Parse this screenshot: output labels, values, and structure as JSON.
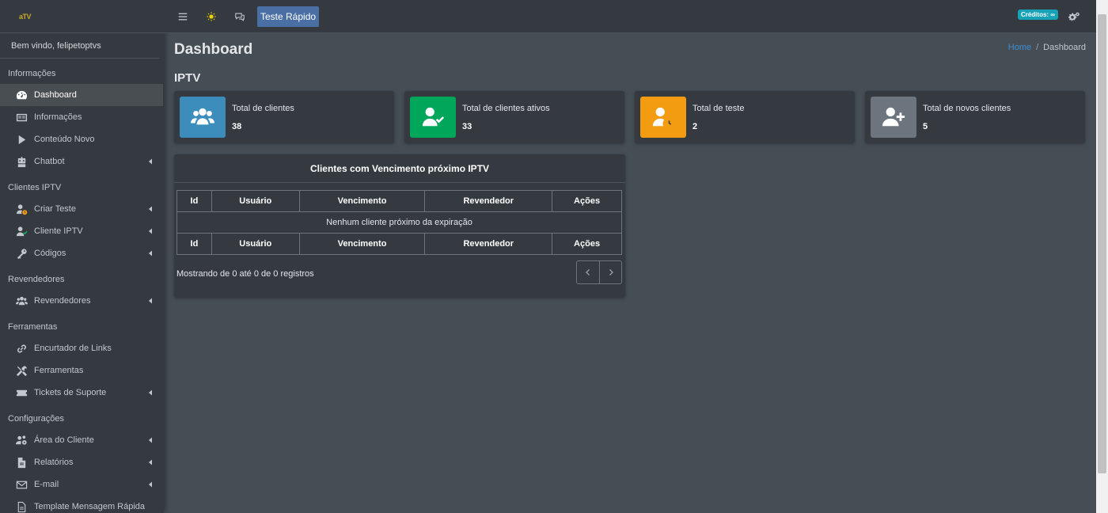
{
  "brand": {
    "logo_text": "aTV"
  },
  "sidebar": {
    "welcome": "Bem vindo, felipetoptvs",
    "sections": [
      {
        "header": "Informações",
        "items": [
          {
            "label": "Dashboard",
            "icon": "dashboard-icon",
            "active": true,
            "has_chevron": false
          },
          {
            "label": "Informações",
            "icon": "id-card-icon",
            "has_chevron": false
          },
          {
            "label": "Conteúdo Novo",
            "icon": "play-icon",
            "has_chevron": false
          },
          {
            "label": "Chatbot",
            "icon": "robot-icon",
            "has_chevron": true
          }
        ]
      },
      {
        "header": "Clientes IPTV",
        "items": [
          {
            "label": "Criar Teste",
            "icon": "user-clock-icon",
            "has_chevron": true
          },
          {
            "label": "Cliente IPTV",
            "icon": "user-check-icon",
            "has_chevron": true
          },
          {
            "label": "Códigos",
            "icon": "key-icon",
            "has_chevron": true
          }
        ]
      },
      {
        "header": "Revendedores",
        "items": [
          {
            "label": "Revendedores",
            "icon": "users-icon",
            "has_chevron": true
          }
        ]
      },
      {
        "header": "Ferramentas",
        "items": [
          {
            "label": "Encurtador de Links",
            "icon": "link-icon",
            "has_chevron": false
          },
          {
            "label": "Ferramentas",
            "icon": "tools-icon",
            "has_chevron": false
          },
          {
            "label": "Tickets de Suporte",
            "icon": "ticket-icon",
            "has_chevron": true
          }
        ]
      },
      {
        "header": "Configurações",
        "items": [
          {
            "label": "Área do Cliente",
            "icon": "users-cog-icon",
            "has_chevron": true
          },
          {
            "label": "Relatórios",
            "icon": "file-icon",
            "has_chevron": true
          },
          {
            "label": "E-mail",
            "icon": "envelope-icon",
            "has_chevron": true
          },
          {
            "label": "Template Mensagem Rápida",
            "icon": "file-alt-icon",
            "has_chevron": false
          }
        ]
      }
    ]
  },
  "topbar": {
    "test_button": "Teste Rápido",
    "credits": "Créditos: ∞"
  },
  "page": {
    "title": "Dashboard",
    "breadcrumb_home": "Home",
    "breadcrumb_sep": "/",
    "breadcrumb_current": "Dashboard",
    "section": "IPTV"
  },
  "info_boxes": [
    {
      "label": "Total de clientes",
      "value": "38",
      "color": "#3c8dbc",
      "icon": "users-icon"
    },
    {
      "label": "Total de clientes ativos",
      "value": "33",
      "color": "#00a65a",
      "icon": "user-check-icon"
    },
    {
      "label": "Total de teste",
      "value": "2",
      "color": "#f39c12",
      "icon": "user-clock-icon"
    },
    {
      "label": "Total de novos clientes",
      "value": "5",
      "color": "#6c757d",
      "icon": "user-plus-icon"
    }
  ],
  "expiring_table": {
    "title": "Clientes com Vencimento próximo IPTV",
    "columns": [
      "Id",
      "Usuário",
      "Vencimento",
      "Revendedor",
      "Ações"
    ],
    "empty_message": "Nenhum cliente próximo da expiração",
    "showing": "Mostrando de 0 até 0 de 0 registros"
  },
  "colors": {
    "accent": "#4a6fa5",
    "credits_badge": "#17a2b8",
    "breadcrumb_link": "#3f8ed8"
  }
}
